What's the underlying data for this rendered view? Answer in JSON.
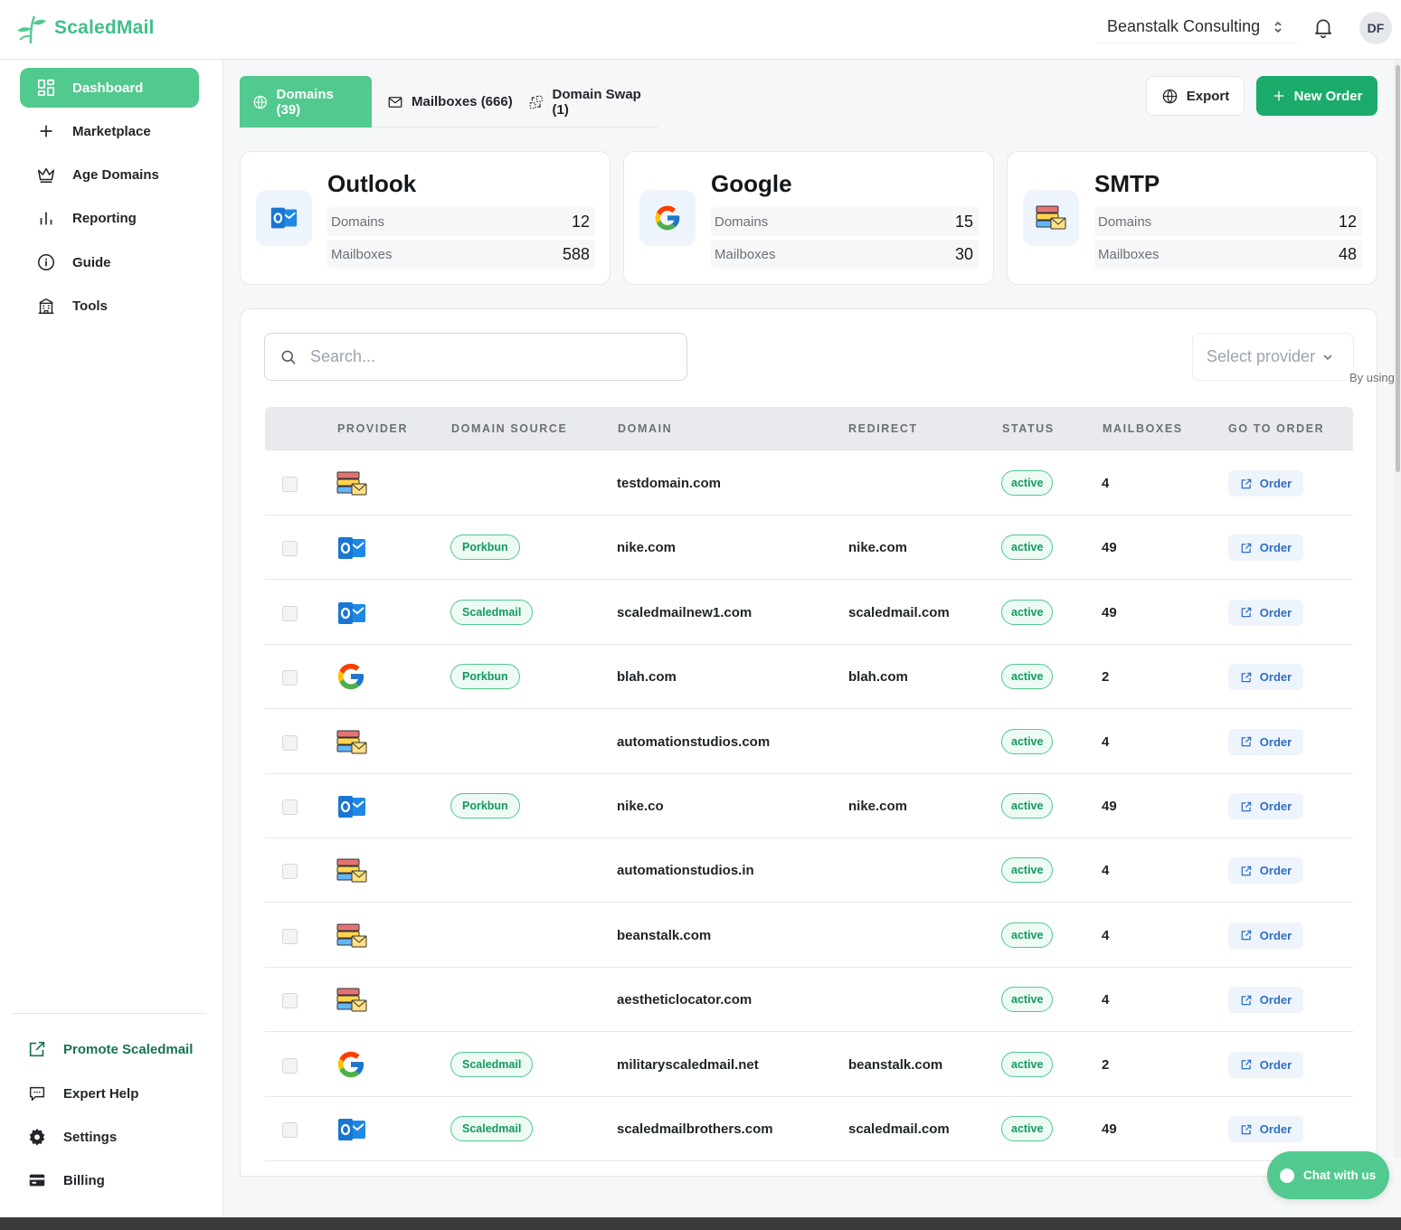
{
  "brand": {
    "name": "ScaledMail",
    "logo_icon": "leaf-sprout-icon",
    "accent": "#52c98e",
    "primary": "#1bab6b"
  },
  "header": {
    "org_name": "Beanstalk Consulting",
    "avatar_initials": "DF"
  },
  "sidebar": {
    "items": [
      {
        "label": "Dashboard",
        "icon": "dashboard-icon",
        "active": true
      },
      {
        "label": "Marketplace",
        "icon": "plus-icon"
      },
      {
        "label": "Age Domains",
        "icon": "crown-icon"
      },
      {
        "label": "Reporting",
        "icon": "bar-chart-icon"
      },
      {
        "label": "Guide",
        "icon": "info-icon"
      },
      {
        "label": "Tools",
        "icon": "building-icon"
      }
    ],
    "footer": [
      {
        "label": "Promote Scaledmail",
        "icon": "external-link-icon"
      },
      {
        "label": "Expert Help",
        "icon": "chat-bubble-icon"
      },
      {
        "label": "Settings",
        "icon": "gear-icon"
      },
      {
        "label": "Billing",
        "icon": "credit-card-icon"
      }
    ]
  },
  "tabs": [
    {
      "label": "Domains (39)",
      "icon": "globe-icon",
      "active": true
    },
    {
      "label": "Mailboxes (666)",
      "icon": "mail-icon"
    },
    {
      "label": "Domain Swap (1)",
      "icon": "swap-icon"
    }
  ],
  "actions": {
    "export_label": "Export",
    "new_order_label": "New Order"
  },
  "providers": [
    {
      "name": "Outlook",
      "icon": "outlook-icon",
      "domains_label": "Domains",
      "domains": "12",
      "mailboxes_label": "Mailboxes",
      "mailboxes": "588"
    },
    {
      "name": "Google",
      "icon": "google-icon",
      "domains_label": "Domains",
      "domains": "15",
      "mailboxes_label": "Mailboxes",
      "mailboxes": "30"
    },
    {
      "name": "SMTP",
      "icon": "smtp-server-icon",
      "domains_label": "Domains",
      "domains": "12",
      "mailboxes_label": "Mailboxes",
      "mailboxes": "48"
    }
  ],
  "table": {
    "search_placeholder": "Search...",
    "provider_select_placeholder": "Select provider",
    "side_note": "By using",
    "columns": [
      "PROVIDER",
      "DOMAIN SOURCE",
      "DOMAIN",
      "REDIRECT",
      "STATUS",
      "MAILBOXES",
      "GO TO ORDER"
    ],
    "order_label": "Order",
    "rows": [
      {
        "provider": "smtp",
        "source": "",
        "domain": "testdomain.com",
        "redirect": "",
        "status": "active",
        "mailboxes": "4"
      },
      {
        "provider": "outlook",
        "source": "Porkbun",
        "domain": "nike.com",
        "redirect": "nike.com",
        "status": "active",
        "mailboxes": "49"
      },
      {
        "provider": "outlook",
        "source": "Scaledmail",
        "domain": "scaledmailnew1.com",
        "redirect": "scaledmail.com",
        "status": "active",
        "mailboxes": "49"
      },
      {
        "provider": "google",
        "source": "Porkbun",
        "domain": "blah.com",
        "redirect": "blah.com",
        "status": "active",
        "mailboxes": "2"
      },
      {
        "provider": "smtp",
        "source": "",
        "domain": "automationstudios.com",
        "redirect": "",
        "status": "active",
        "mailboxes": "4"
      },
      {
        "provider": "outlook",
        "source": "Porkbun",
        "domain": "nike.co",
        "redirect": "nike.com",
        "status": "active",
        "mailboxes": "49"
      },
      {
        "provider": "smtp",
        "source": "",
        "domain": "automationstudios.in",
        "redirect": "",
        "status": "active",
        "mailboxes": "4"
      },
      {
        "provider": "smtp",
        "source": "",
        "domain": "beanstalk.com",
        "redirect": "",
        "status": "active",
        "mailboxes": "4"
      },
      {
        "provider": "smtp",
        "source": "",
        "domain": "aestheticlocator.com",
        "redirect": "",
        "status": "active",
        "mailboxes": "4"
      },
      {
        "provider": "google",
        "source": "Scaledmail",
        "domain": "militaryscaledmail.net",
        "redirect": "beanstalk.com",
        "status": "active",
        "mailboxes": "2"
      },
      {
        "provider": "outlook",
        "source": "Scaledmail",
        "domain": "scaledmailbrothers.com",
        "redirect": "scaledmail.com",
        "status": "active",
        "mailboxes": "49"
      }
    ]
  },
  "chat": {
    "label": "Chat with us"
  }
}
